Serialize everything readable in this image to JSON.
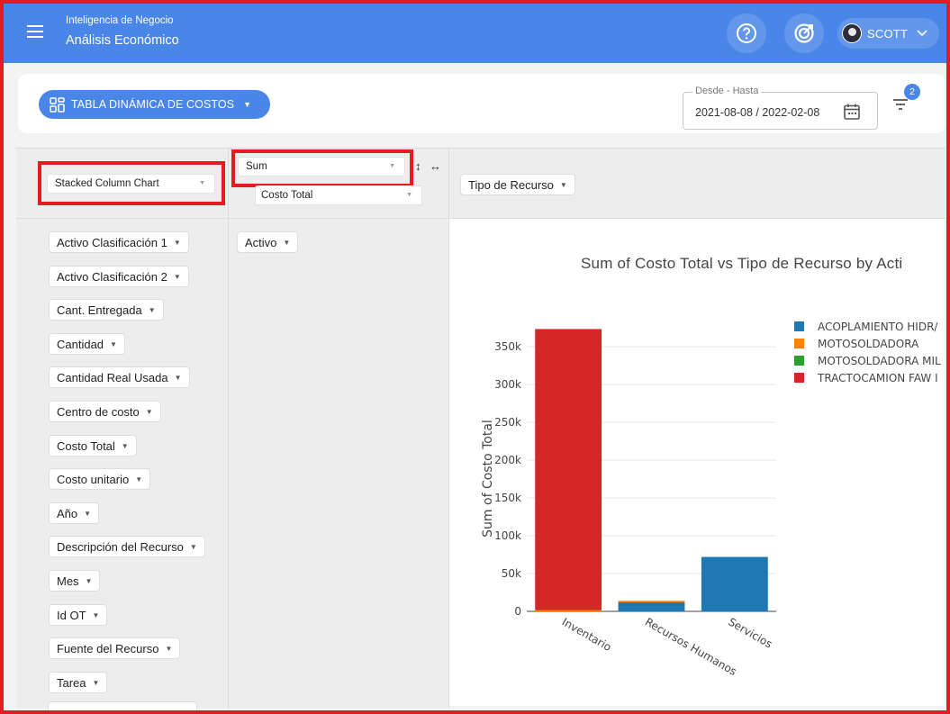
{
  "header": {
    "title": "Inteligencia de Negocio",
    "subtitle": "Análisis Económico",
    "user": "SCOTT"
  },
  "toolbar": {
    "report_label": "TABLA DINÁMICA DE COSTOS",
    "date_legend": "Desde - Hasta",
    "date_range": "2021-08-08 / 2022-02-08",
    "filter_count": "2"
  },
  "pivot": {
    "renderer": "Stacked Column Chart",
    "aggregator": "Sum",
    "aggregator_field": "Costo Total",
    "column_field": "Tipo de Recurso",
    "row_field": "Activo",
    "unused_fields": [
      "Activo Clasificación 1",
      "Activo Clasificación 2",
      "Cant. Entregada",
      "Cantidad",
      "Cantidad Real Usada",
      "Centro de costo",
      "Costo Total",
      "Costo unitario",
      "Año",
      "Descripción del Recurso",
      "Mes",
      "Id OT",
      "Fuente del Recurso",
      "Tarea"
    ]
  },
  "chart_data": {
    "type": "bar",
    "stacked": true,
    "title": "Sum of Costo Total vs Tipo de Recurso by Acti",
    "xlabel": "",
    "ylabel": "Sum of Costo Total",
    "categories": [
      "Inventario",
      "Recursos Humanos",
      "Servicios"
    ],
    "ylim": [
      0,
      380000
    ],
    "yticks": [
      "0",
      "50k",
      "100k",
      "150k",
      "200k",
      "250k",
      "300k",
      "350k"
    ],
    "ytick_values": [
      0,
      50000,
      100000,
      150000,
      200000,
      250000,
      300000,
      350000
    ],
    "series": [
      {
        "name": "ACOPLAMIENTO HIDR/",
        "color": "#1f77b4",
        "values": [
          0,
          12000,
          72000
        ]
      },
      {
        "name": "MOTOSOLDADORA",
        "color": "#ff7f0e",
        "values": [
          1500,
          2000,
          0
        ]
      },
      {
        "name": "MOTOSOLDADORA MIL",
        "color": "#2ca02c",
        "values": [
          0,
          0,
          0
        ]
      },
      {
        "name": "TRACTOCAMION FAW I",
        "color": "#d62728",
        "values": [
          372000,
          0,
          0
        ]
      }
    ],
    "legend_position": "right",
    "grid": true
  }
}
